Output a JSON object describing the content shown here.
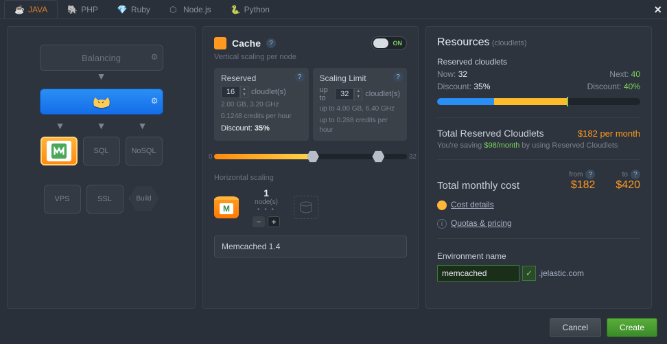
{
  "tabs": {
    "java": "JAVA",
    "php": "PHP",
    "ruby": "Ruby",
    "node": "Node.js",
    "python": "Python"
  },
  "left": {
    "balancing": "Balancing",
    "sql": "SQL",
    "nosql": "NoSQL",
    "vps": "VPS",
    "ssl": "SSL",
    "build": "Build"
  },
  "mid": {
    "title": "Cache",
    "toggle": "ON",
    "vscale": "Vertical scaling per node",
    "reserved": {
      "title": "Reserved",
      "value": "16",
      "unit": "cloudlet(s)",
      "l1": "2.00 GB, 3.20 GHz",
      "l2": "0.1248 credits per hour",
      "disc": "Discount:",
      "discv": "35%"
    },
    "limit": {
      "title": "Scaling Limit",
      "pre": "up to",
      "value": "32",
      "unit": "cloudlet(s)",
      "l1": "up to 4.00 GB, 6.40 GHz",
      "l2": "up to 0.288 credits per hour"
    },
    "slider": {
      "min": "0",
      "max": "32"
    },
    "hscale": "Horizontal scaling",
    "nodes": {
      "count": "1",
      "label": "node(s)"
    },
    "memname": "Memcached 1.4"
  },
  "right": {
    "title": "Resources",
    "sub": "(cloudlets)",
    "res_title": "Reserved cloudlets",
    "now_l": "Now:",
    "now_v": "32",
    "next_l": "Next:",
    "next_v": "40",
    "disc_l": "Discount:",
    "disc_now": "35%",
    "disc_next": "40%",
    "trc": "Total Reserved Cloudlets",
    "trc_v": "$182 per month",
    "saving_pre": "You're saving ",
    "saving_v": "$98/month",
    "saving_post": " by using Reserved Cloudlets",
    "from": "from",
    "to": "to",
    "tmc": "Total monthly cost",
    "tmc_from": "$182",
    "tmc_to": "$420",
    "cost": "Cost details",
    "quotas": "Quotas & pricing",
    "env_l": "Environment name",
    "env_v": "memcached",
    "domain": ".jelastic.com"
  },
  "footer": {
    "cancel": "Cancel",
    "create": "Create"
  }
}
